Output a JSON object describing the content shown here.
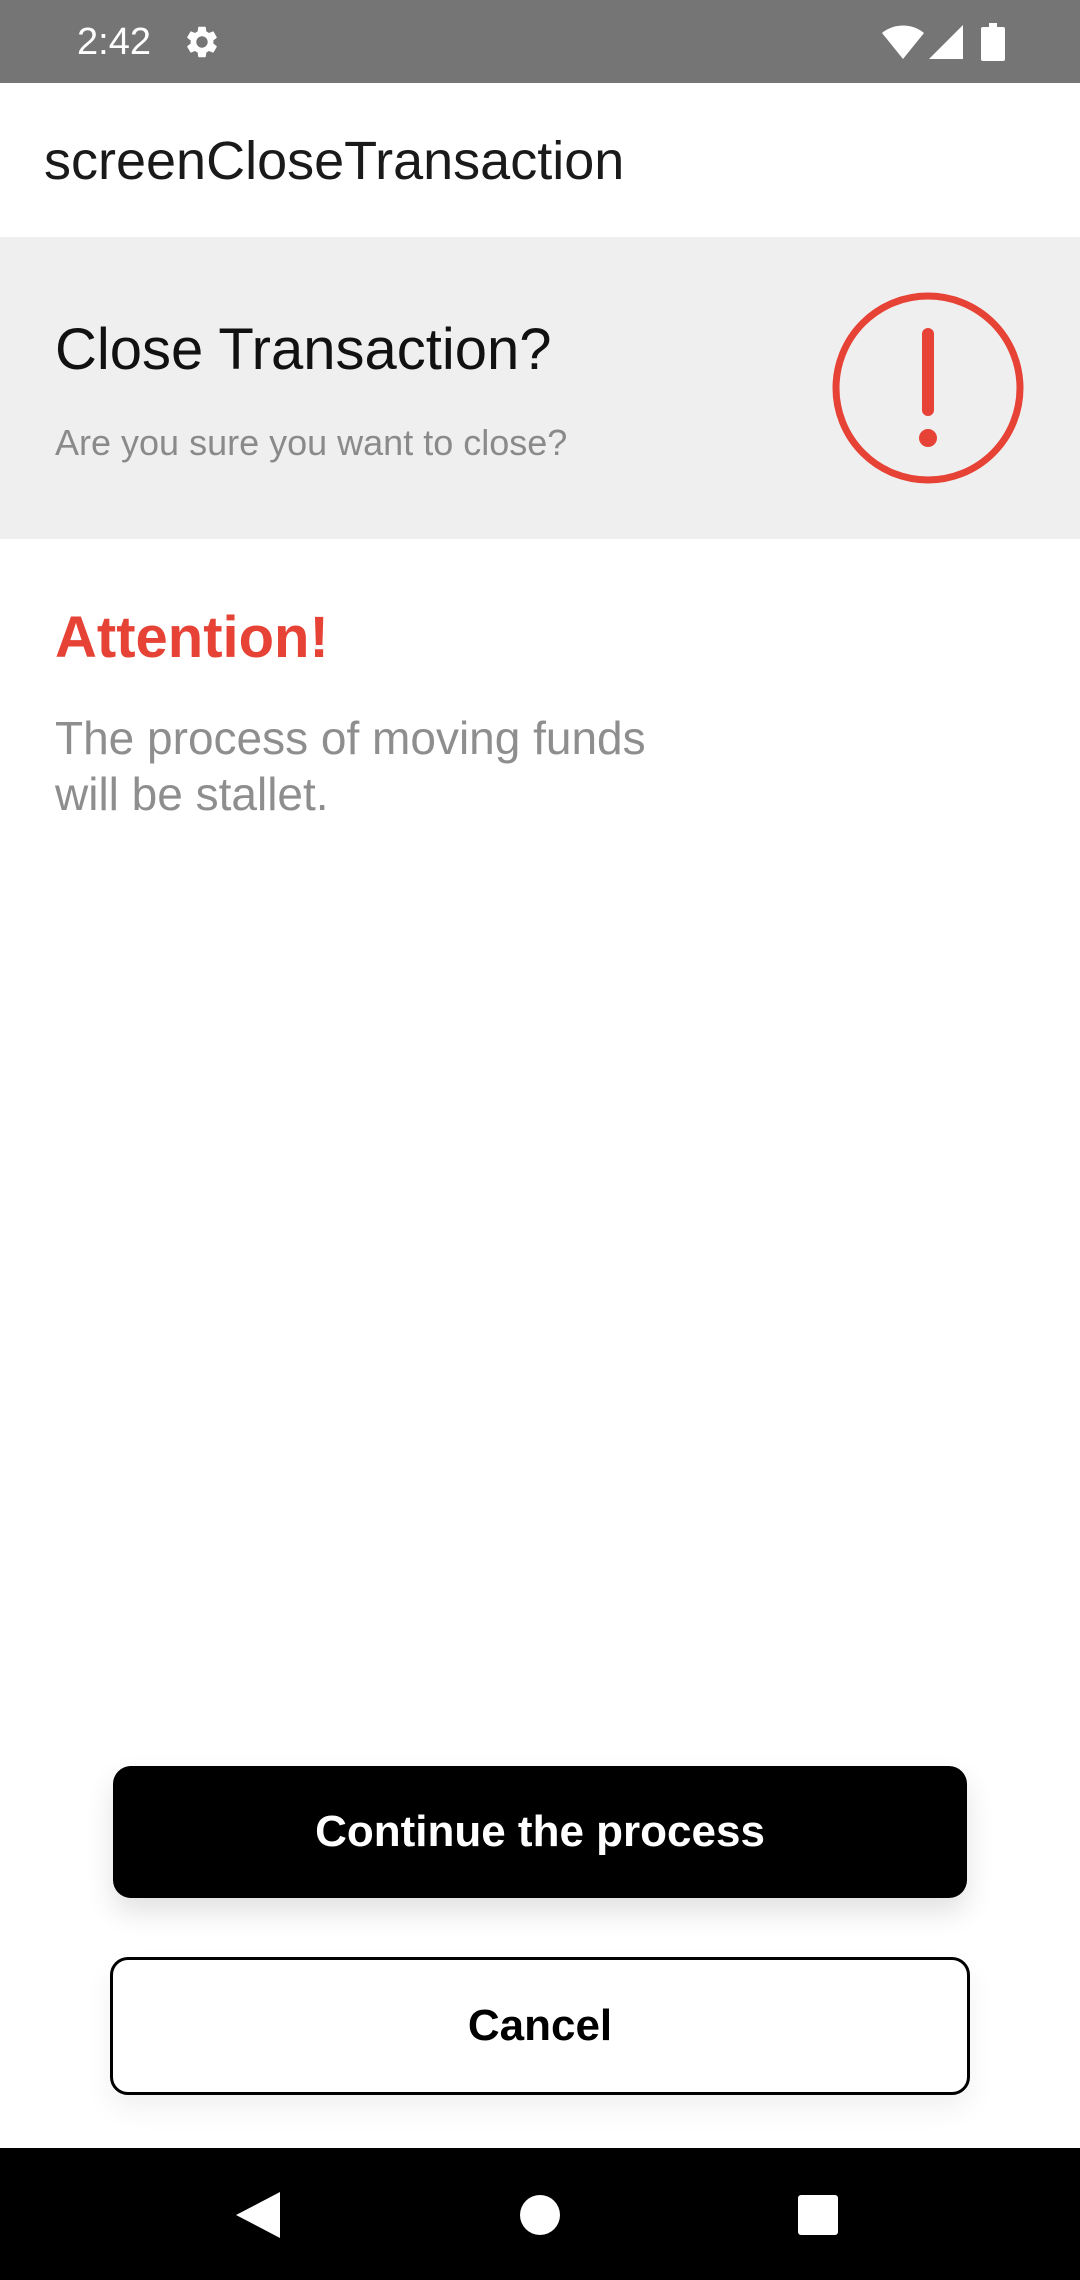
{
  "status_bar": {
    "time": "2:42",
    "icons": [
      "gear-icon",
      "wifi-icon",
      "cell-signal-icon",
      "battery-icon"
    ]
  },
  "app_bar": {
    "title": "screenCloseTransaction"
  },
  "header": {
    "title": "Close Transaction?",
    "subtitle": "Are you sure you want to close?",
    "icon": "alert-circle-icon"
  },
  "attention": {
    "title": "Attention!",
    "body": "The process of moving funds\nwill be stallet."
  },
  "buttons": {
    "continue_label": "Continue the process",
    "cancel_label": "Cancel"
  },
  "navigation": {
    "icons": [
      "back-icon",
      "home-icon",
      "recents-icon"
    ]
  },
  "colors": {
    "status_bar": "#757575",
    "header_bg": "#f0eff0",
    "accent_red": "#e64235",
    "muted_text": "#8e8e8e",
    "primary_button": "#000000"
  }
}
